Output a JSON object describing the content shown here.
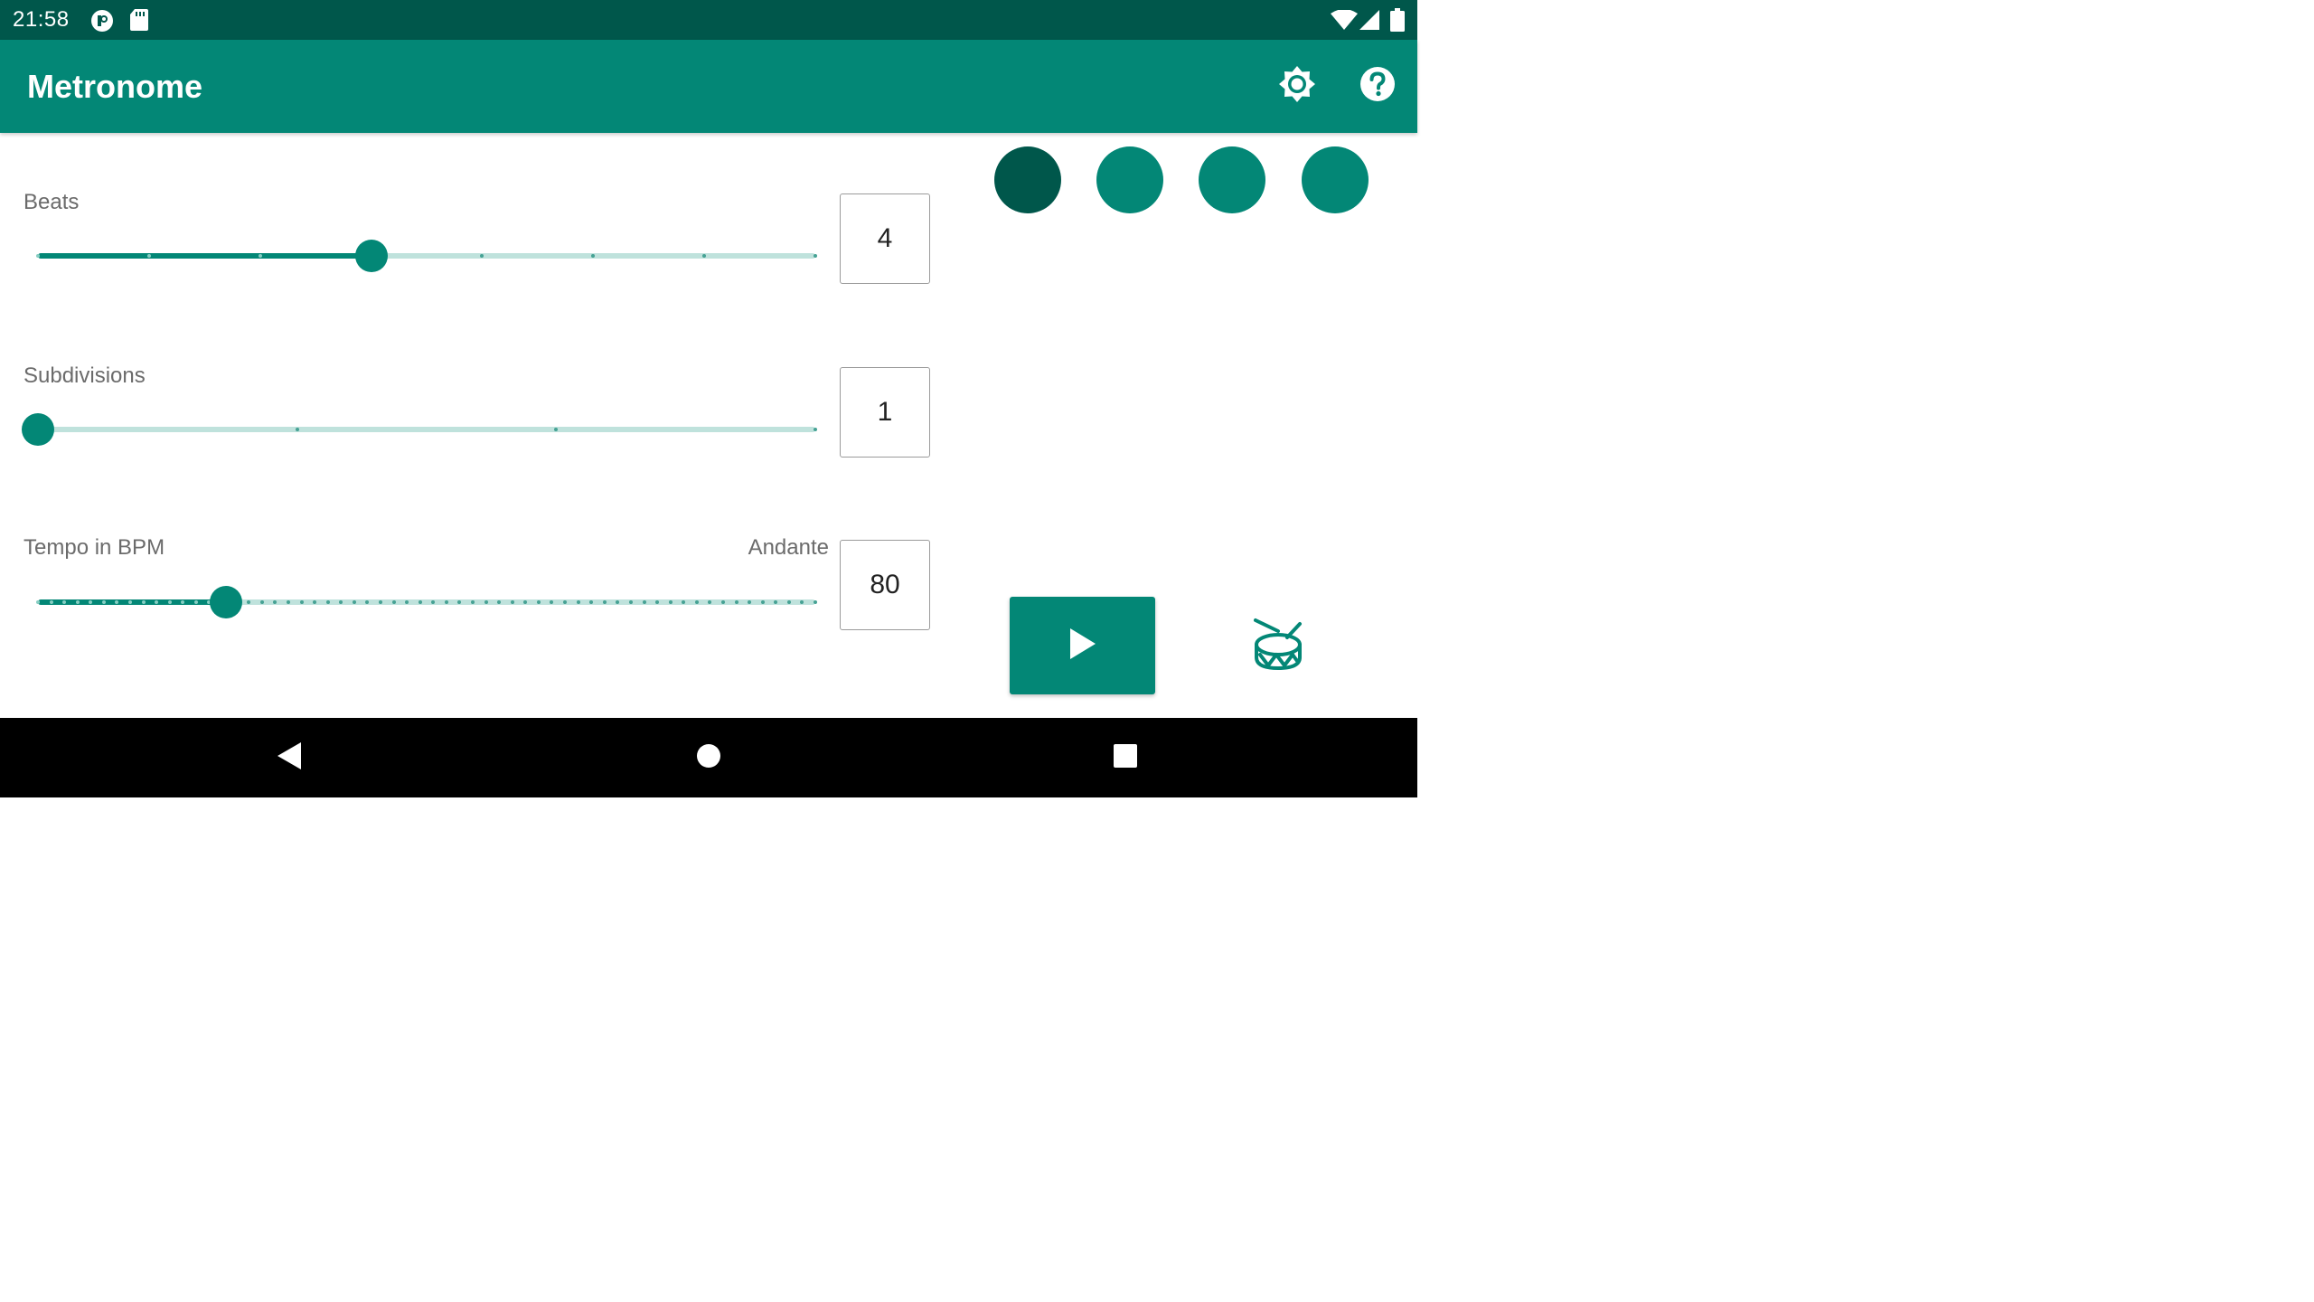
{
  "status_bar": {
    "time": "21:58",
    "icons": [
      "app-notification-icon",
      "sd-card-icon",
      "wifi-icon",
      "cell-signal-icon",
      "battery-icon"
    ]
  },
  "app_bar": {
    "title": "Metronome",
    "actions": [
      "brightness-settings-icon",
      "help-icon"
    ]
  },
  "beats": {
    "label": "Beats",
    "value": "4",
    "slider_fraction": 0.4286
  },
  "subdivisions": {
    "label": "Subdivisions",
    "value": "1",
    "slider_fraction": 0
  },
  "tempo": {
    "label": "Tempo in BPM",
    "tempo_name": "Andante",
    "value": "80",
    "slider_fraction": 0.2414
  },
  "beat_indicators": {
    "count": 4,
    "active_index": 0
  },
  "controls": {
    "play_icon": "play-icon",
    "sound_icon": "drum-icon"
  },
  "navigation": [
    "back-icon",
    "home-icon",
    "recents-icon"
  ],
  "colors": {
    "status_bar": "#00574b",
    "primary": "#038776",
    "primary_dark": "#00574b",
    "track_inactive": "#bfe2dc"
  }
}
